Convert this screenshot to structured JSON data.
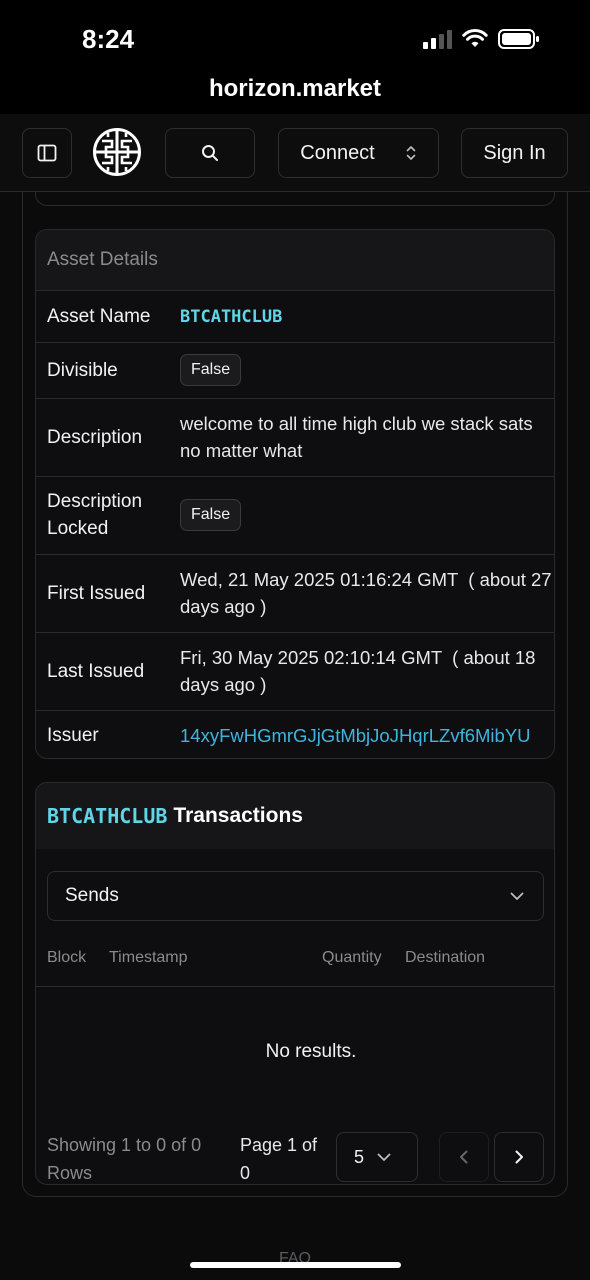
{
  "status": {
    "time": "8:24"
  },
  "browser": {
    "url": "horizon.market"
  },
  "header": {
    "connect_label": "Connect",
    "signin_label": "Sign In"
  },
  "details": {
    "title": "Asset Details",
    "rows": {
      "asset_name": {
        "label": "Asset Name",
        "value": "BTCATHCLUB"
      },
      "divisible": {
        "label": "Divisible",
        "value": "False"
      },
      "description": {
        "label": "Description",
        "value": "welcome to all time high club we stack sats no matter what"
      },
      "description_locked": {
        "label": "Description Locked",
        "value": "False"
      },
      "first_issued": {
        "label": "First Issued",
        "value": "Wed, 21 May 2025 01:16:24 GMT  ( about 27 days ago )"
      },
      "last_issued": {
        "label": "Last Issued",
        "value": "Fri, 30 May 2025 02:10:14 GMT  ( about 18 days ago )"
      },
      "issuer": {
        "label": "Issuer",
        "value": "14xyFwHGmrGJjGtMbjJoJHqrLZvf6MibYU"
      }
    }
  },
  "transactions": {
    "asset": "BTCATHCLUB",
    "title": "Transactions",
    "filter_selected": "Sends",
    "columns": [
      "Block",
      "Timestamp",
      "Quantity",
      "Destination"
    ],
    "empty_text": "No results.",
    "pagination": {
      "showing": "Showing 1 to 0 of 0 Rows",
      "page": "Page 1 of 0",
      "page_size": "5"
    }
  },
  "footer": {
    "faq": "FAQ"
  },
  "colors": {
    "accent": "#5fd6e8",
    "link": "#3fb5de",
    "background": "#0b0b0c"
  }
}
